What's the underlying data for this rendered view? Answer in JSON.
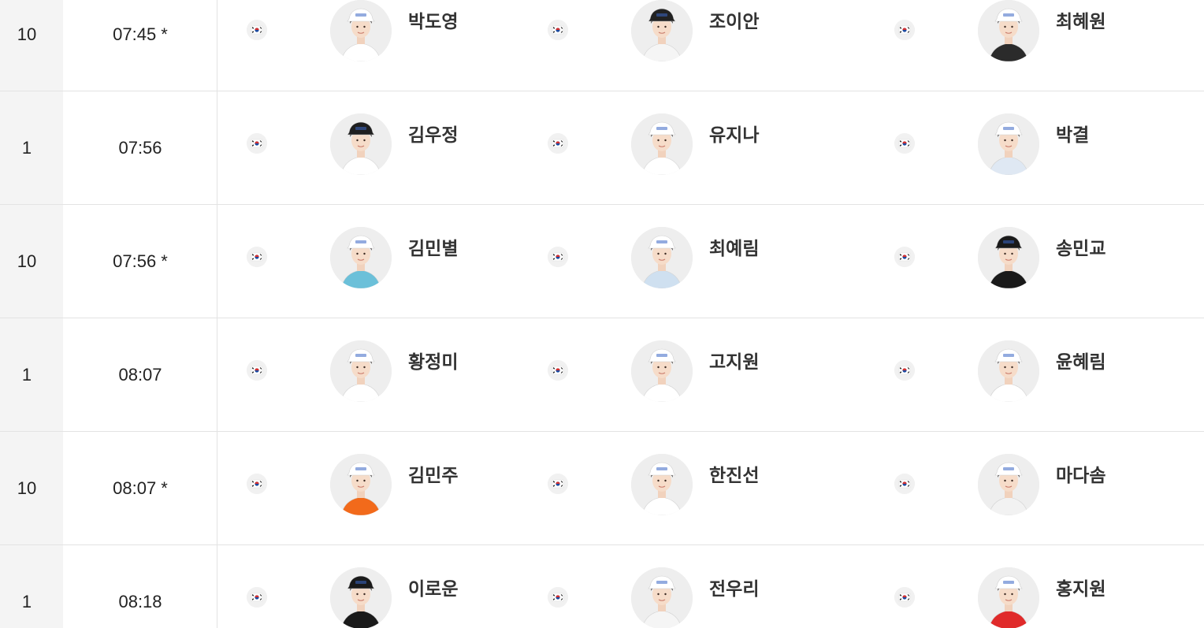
{
  "rows": [
    {
      "tee": "10",
      "time": "07:45 *",
      "players": [
        {
          "name": "박도영",
          "flag": "korea-flag-icon",
          "cap": "#ffffff",
          "shirt": "#ffffff"
        },
        {
          "name": "조이안",
          "flag": "korea-flag-icon",
          "cap": "#222222",
          "shirt": "#f5f5f5"
        },
        {
          "name": "최혜원",
          "flag": "korea-flag-icon",
          "cap": "#ffffff",
          "shirt": "#2b2b2b"
        }
      ]
    },
    {
      "tee": "1",
      "time": "07:56",
      "players": [
        {
          "name": "김우정",
          "flag": "korea-flag-icon",
          "cap": "#1f1f1f",
          "shirt": "#ffffff"
        },
        {
          "name": "유지나",
          "flag": "korea-flag-icon",
          "cap": "#ffffff",
          "shirt": "#ffffff"
        },
        {
          "name": "박결",
          "flag": "korea-flag-icon",
          "cap": "#ffffff",
          "shirt": "#dfe8f3"
        }
      ]
    },
    {
      "tee": "10",
      "time": "07:56 *",
      "players": [
        {
          "name": "김민별",
          "flag": "korea-flag-icon",
          "cap": "#ffffff",
          "shirt": "#6bc0d9"
        },
        {
          "name": "최예림",
          "flag": "korea-flag-icon",
          "cap": "#ffffff",
          "shirt": "#cfe0f0"
        },
        {
          "name": "송민교",
          "flag": "korea-flag-icon",
          "cap": "#1a1a1a",
          "shirt": "#1a1a1a"
        }
      ]
    },
    {
      "tee": "1",
      "time": "08:07",
      "players": [
        {
          "name": "황정미",
          "flag": "korea-flag-icon",
          "cap": "#ffffff",
          "shirt": "#ffffff"
        },
        {
          "name": "고지원",
          "flag": "korea-flag-icon",
          "cap": "#ffffff",
          "shirt": "#ffffff"
        },
        {
          "name": "윤혜림",
          "flag": "korea-flag-icon",
          "cap": "#ffffff",
          "shirt": "#ffffff"
        }
      ]
    },
    {
      "tee": "10",
      "time": "08:07 *",
      "players": [
        {
          "name": "김민주",
          "flag": "korea-flag-icon",
          "cap": "#ffffff",
          "shirt": "#f26a1b"
        },
        {
          "name": "한진선",
          "flag": "korea-flag-icon",
          "cap": "#ffffff",
          "shirt": "#ffffff"
        },
        {
          "name": "마다솜",
          "flag": "korea-flag-icon",
          "cap": "#ffffff",
          "shirt": "#f2f2f2"
        }
      ]
    },
    {
      "tee": "1",
      "time": "08:18",
      "players": [
        {
          "name": "이로운",
          "flag": "korea-flag-icon",
          "cap": "#1a1a1a",
          "shirt": "#1a1a1a"
        },
        {
          "name": "전우리",
          "flag": "korea-flag-icon",
          "cap": "#ffffff",
          "shirt": "#f5f5f5"
        },
        {
          "name": "홍지원",
          "flag": "korea-flag-icon",
          "cap": "#ffffff",
          "shirt": "#e02a2a"
        }
      ]
    }
  ],
  "colors": {
    "tee_cell_bg": "#f4f4f4",
    "divider": "#e3e3e3",
    "text": "#222222"
  }
}
